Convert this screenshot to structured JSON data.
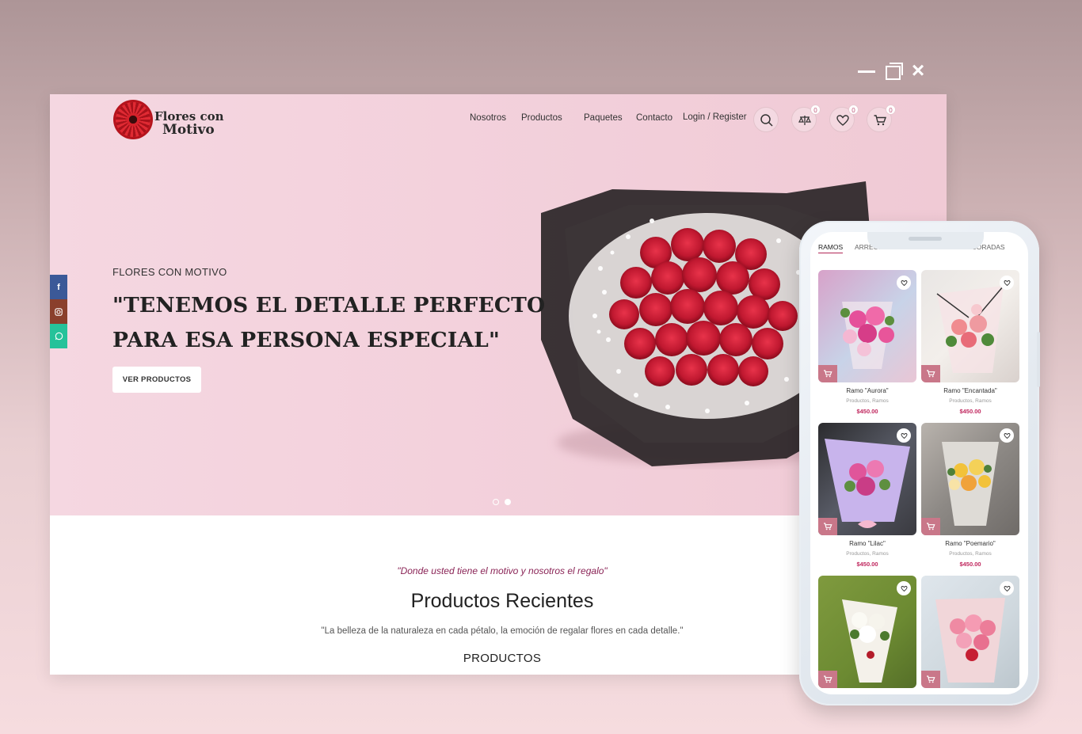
{
  "site": {
    "logo": {
      "line1": "Flores con",
      "line2": "Motivo"
    },
    "nav": [
      "Nosotros",
      "Productos",
      "Paquetes",
      "Contacto",
      "Login / Register"
    ],
    "badges": {
      "compare": "0",
      "wishlist": "0",
      "cart": "0"
    },
    "hero": {
      "kicker": "FLORES CON MOTIVO",
      "title_line1": "\"TENEMOS EL DETALLE PERFECTO",
      "title_line2": "PARA ESA PERSONA ESPECIAL\"",
      "button": "VER PRODUCTOS"
    },
    "section": {
      "quote": "\"Donde usted tiene el motivo y nosotros el regalo\"",
      "title": "Productos Recientes",
      "subtitle": "\"La belleza de la naturaleza en cada pétalo, la emoción de regalar flores en cada detalle.\"",
      "label": "PRODUCTOS"
    }
  },
  "phone": {
    "tabs": [
      "RAMOS",
      "ARREGLOS FLORALES",
      "CAJAS DECORADAS"
    ],
    "products": [
      {
        "name": "Ramo \"Aurora\"",
        "category": "Productos, Ramos",
        "price": "$450.00"
      },
      {
        "name": "Ramo \"Encantada\"",
        "category": "Productos, Ramos",
        "price": "$450.00"
      },
      {
        "name": "Ramo \"Lilac\"",
        "category": "Productos, Ramos",
        "price": "$450.00"
      },
      {
        "name": "Ramo \"Poemario\"",
        "category": "Productos, Ramos",
        "price": "$450.00"
      }
    ]
  },
  "colors": {
    "accent": "#c0275e",
    "hero_bg": "#f3d1dc",
    "facebook": "#3b5998",
    "instagram": "#8a3f2c",
    "whatsapp": "#25c29a"
  }
}
